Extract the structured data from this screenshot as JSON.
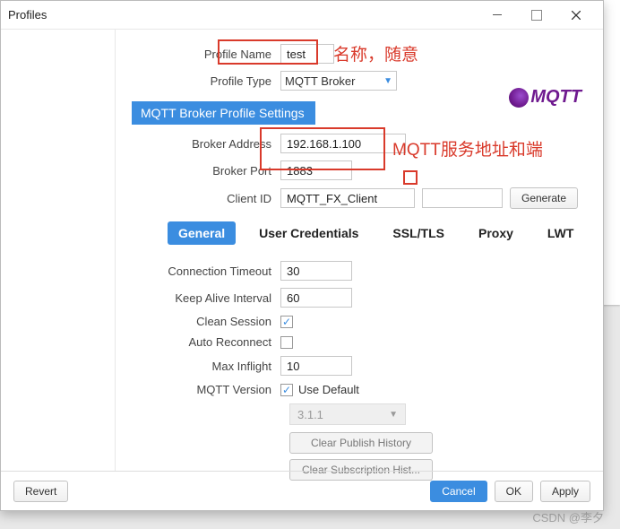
{
  "window": {
    "title": "Profiles"
  },
  "profile": {
    "name_label": "Profile Name",
    "name_value": "test",
    "type_label": "Profile Type",
    "type_value": "MQTT Broker"
  },
  "section_header": "MQTT Broker Profile Settings",
  "broker": {
    "address_label": "Broker Address",
    "address_value": "192.168.1.100",
    "port_label": "Broker Port",
    "port_value": "1883",
    "clientid_label": "Client ID",
    "clientid_value": "MQTT_FX_Client",
    "generate_label": "Generate"
  },
  "tabs": {
    "general": "General",
    "usercred": "User Credentials",
    "ssltls": "SSL/TLS",
    "proxy": "Proxy",
    "lwt": "LWT"
  },
  "general": {
    "conn_timeout_label": "Connection Timeout",
    "conn_timeout_value": "30",
    "keepalive_label": "Keep Alive Interval",
    "keepalive_value": "60",
    "clean_session_label": "Clean Session",
    "auto_reconnect_label": "Auto Reconnect",
    "max_inflight_label": "Max Inflight",
    "max_inflight_value": "10",
    "mqtt_version_label": "MQTT Version",
    "use_default_label": "Use Default",
    "version_value": "3.1.1",
    "clear_pub_label": "Clear Publish History",
    "clear_sub_label": "Clear Subscription Hist..."
  },
  "footer": {
    "revert": "Revert",
    "cancel": "Cancel",
    "ok": "OK",
    "apply": "Apply"
  },
  "logo_text": "MQTT",
  "annotations": {
    "name_hint": "名称，随意",
    "addr_hint": "MQTT服务地址和端"
  },
  "watermark": "CSDN @李夕"
}
